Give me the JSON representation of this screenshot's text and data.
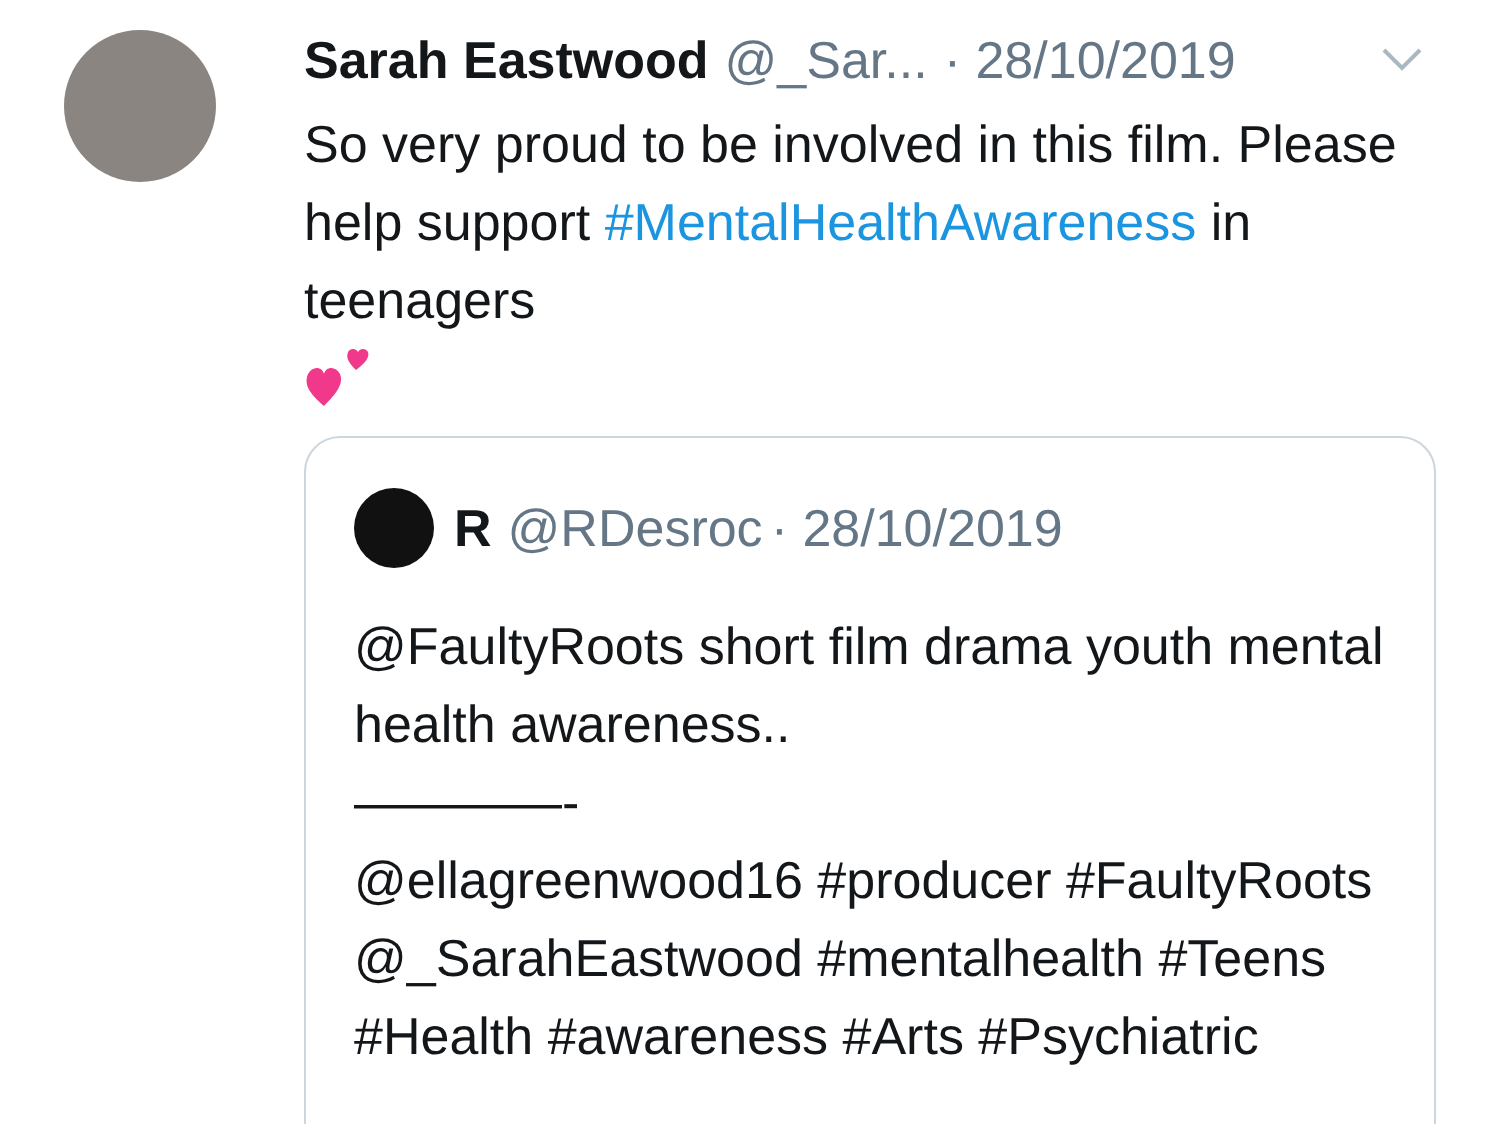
{
  "tweet": {
    "name": "Sarah Eastwood",
    "handle": "@_Sar...",
    "date": "· 28/10/2019",
    "text": [
      {
        "kind": "text",
        "text": "So very proud to be involved in this film. Please help support "
      },
      {
        "kind": "hashtag",
        "text": "#MentalHealthAwareness"
      },
      {
        "kind": "text",
        "text": " in teenagers"
      }
    ],
    "quoted": {
      "name": "R",
      "handle": "@RDesroc",
      "date": "· 28/10/2019",
      "paragraphs": [
        "@FaultyRoots short film drama youth mental health awareness..",
        "————-",
        "@ellagreenwood16 #producer #FaultyRoots @_SarahEastwood #mentalhealth #Teens #Health #awareness #Arts #Psychiatric"
      ]
    }
  }
}
